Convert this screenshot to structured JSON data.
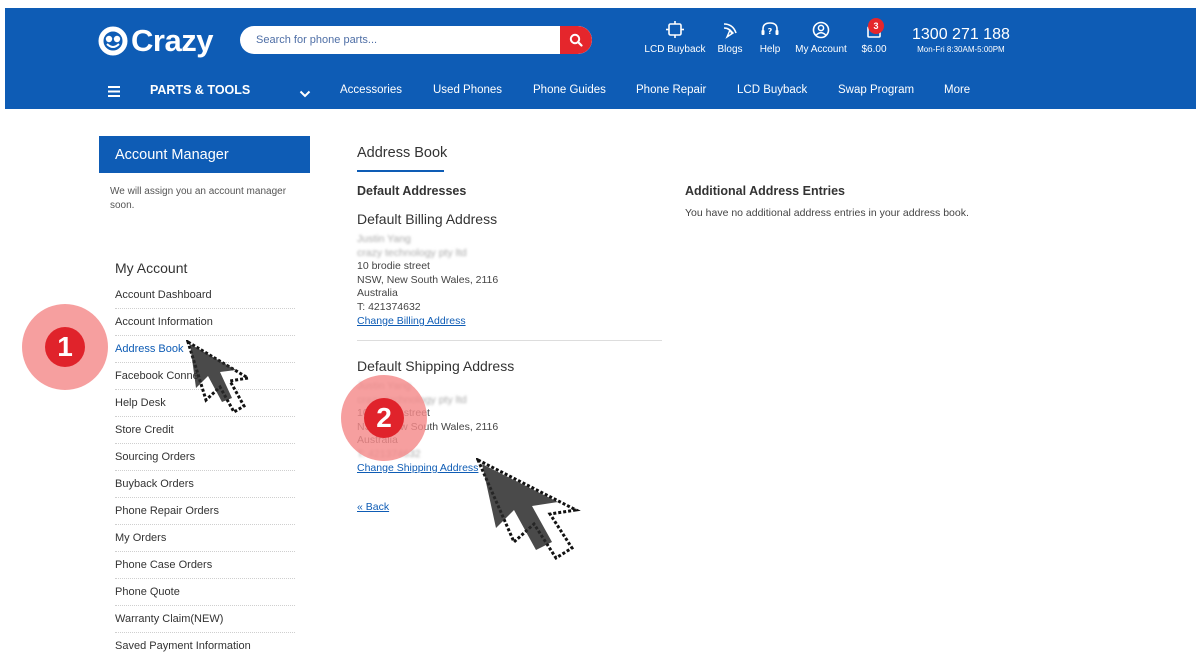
{
  "header": {
    "logo_text": "Crazy",
    "search_placeholder": "Search for phone parts...",
    "top_items": [
      {
        "label": "LCD Buyback",
        "icon": "lcd-buyback-icon"
      },
      {
        "label": "Blogs",
        "icon": "blogs-icon"
      },
      {
        "label": "Help",
        "icon": "help-icon"
      },
      {
        "label": "My Account",
        "icon": "account-icon"
      },
      {
        "label": "$6.00",
        "icon": "cart-icon",
        "badge": "3"
      }
    ],
    "phone": "1300 271 188",
    "hours": "Mon-Fri 8:30AM-5:00PM"
  },
  "nav": {
    "parts": "PARTS & TOOLS",
    "links": [
      "Accessories",
      "Used Phones",
      "Phone Guides",
      "Phone Repair",
      "LCD Buyback",
      "Swap Program",
      "More"
    ]
  },
  "sidebar": {
    "manager_title": "Account Manager",
    "manager_note": "We will assign you an account manager soon.",
    "my_account_title": "My Account",
    "items": [
      "Account Dashboard",
      "Account Information",
      "Address Book",
      "Facebook Connect",
      "Help Desk",
      "Store Credit",
      "Sourcing Orders",
      "Buyback Orders",
      "Phone Repair Orders",
      "My Orders",
      "Phone Case Orders",
      "Phone Quote",
      "Warranty Claim(NEW)",
      "Saved Payment Information"
    ],
    "active_item": "Address Book"
  },
  "main": {
    "title": "Address Book",
    "default_addresses": "Default Addresses",
    "billing": {
      "heading": "Default Billing Address",
      "name": "Justin Yang",
      "company": "crazy technology pty ltd",
      "street": "10 brodie street",
      "region": "NSW, New South Wales, 2116",
      "country": "Australia",
      "phone": "T: 421374632",
      "change_link": "Change Billing Address"
    },
    "shipping": {
      "heading": "Default Shipping Address",
      "name": "Justin Yang",
      "company": "crazy technology pty ltd",
      "street": "10 brodie street",
      "region": "NSW, New South Wales, 2116",
      "country": "Australia",
      "phone": "T: 421374632",
      "change_link": "Change Shipping Address"
    },
    "back_link": "« Back",
    "additional_title": "Additional Address Entries",
    "additional_note": "You have no additional address entries in your address book."
  },
  "overlays": {
    "step1": "1",
    "step2": "2"
  },
  "colors": {
    "brand_blue": "#0e5cb5",
    "accent_red": "#e5262c",
    "step_red": "#e0232b"
  }
}
